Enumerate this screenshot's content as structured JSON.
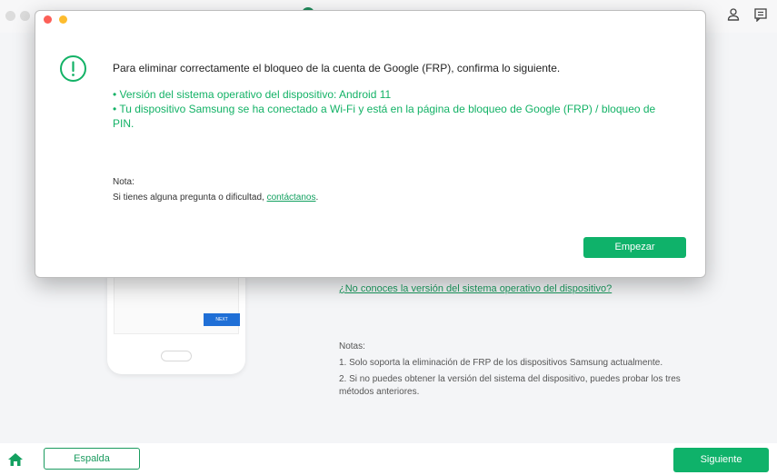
{
  "modal": {
    "heading": "Para eliminar correctamente el bloqueo de la cuenta de Google (FRP), confirma lo siguiente.",
    "bullets": [
      "• Versión del sistema operativo del dispositivo: Android 11",
      "• Tu dispositivo Samsung se ha conectado a Wi-Fi y está en la página de bloqueo de Google (FRP) / bloqueo de PIN."
    ],
    "note_label": "Nota:",
    "note_text": "Si tienes alguna pregunta o dificultad, ",
    "note_link": "contáctanos",
    "note_end": ".",
    "start_button": "Empezar"
  },
  "main": {
    "version_link": "¿No conoces la versión del sistema operativo del dispositivo?",
    "phone_next_label": "NEXT",
    "notes_title": "Notas:",
    "notes": [
      "1. Solo soporta la eliminación de FRP de los dispositivos Samsung actualmente.",
      "2. Si no puedes obtener la versión del sistema del dispositivo, puedes probar los tres métodos anteriores."
    ]
  },
  "bottombar": {
    "back_label": "Espalda",
    "next_label": "Siguiente"
  },
  "colors": {
    "accent": "#0fb26a",
    "close": "#fc5f57",
    "minimize": "#fdbc2e"
  },
  "icons": {
    "alert": "alert-circle-icon",
    "home": "home-icon",
    "user": "user-icon",
    "feedback": "feedback-icon"
  }
}
